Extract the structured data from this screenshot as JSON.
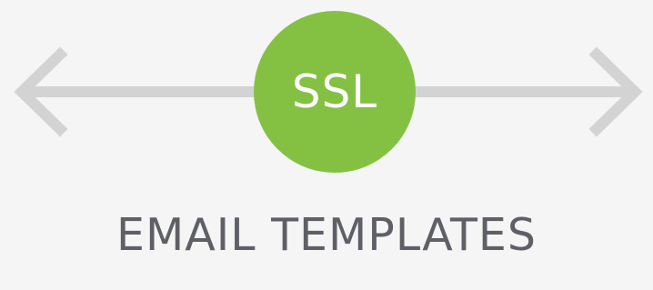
{
  "badge": {
    "label": "SSL",
    "color": "#84c143"
  },
  "caption": {
    "text": "EMAIL TEMPLATES",
    "color": "#5e6066"
  },
  "arrow": {
    "color": "#d3d3d3",
    "icon": "double-headed-arrow-icon"
  }
}
